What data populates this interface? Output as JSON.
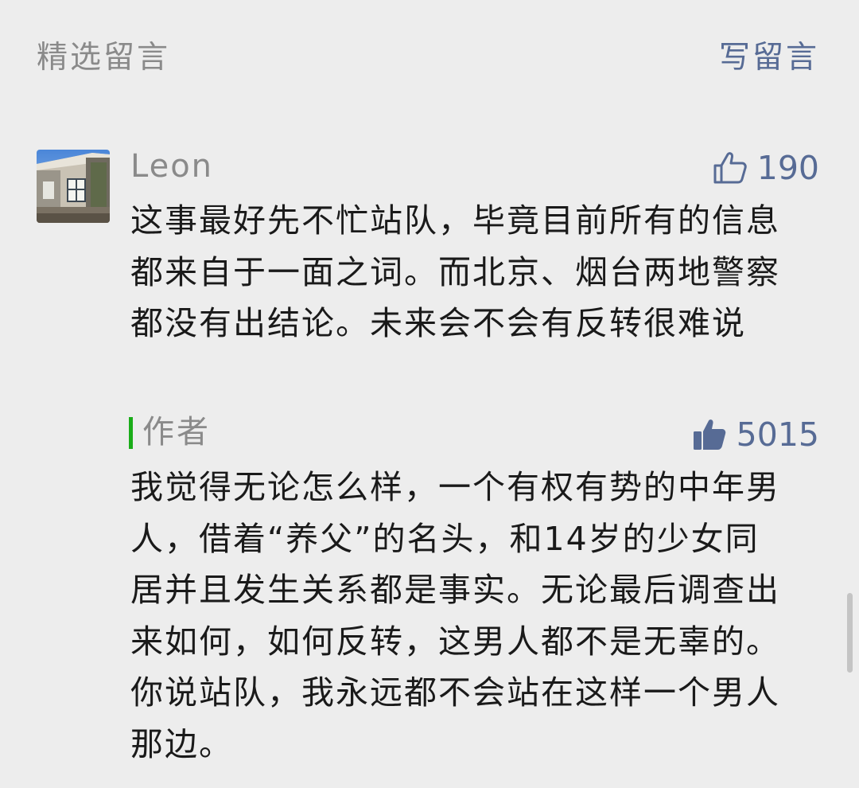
{
  "header": {
    "title": "精选留言",
    "write_label": "写留言"
  },
  "comment": {
    "user": "Leon",
    "likes": "190",
    "text": "这事最好先不忙站队，毕竟目前所有的信息都来自于一面之词。而北京、烟台两地警察都没有出结论。未来会不会有反转很难说"
  },
  "reply": {
    "author_label": "作者",
    "likes": "5015",
    "text": "我觉得无论怎么样，一个有权有势的中年男人，借着“养父”的名头，和14岁的少女同居并且发生关系都是事实。无论最后调查出来如何，如何反转，这男人都不是无辜的。你说站队，我永远都不会站在这样一个男人那边。"
  },
  "colors": {
    "background": "#ededed",
    "link": "#576b95",
    "muted": "#8a8a8a",
    "text": "#1a1a1a",
    "author_accent": "#1aad19"
  },
  "icons": {
    "like_outline": "thumbs-up-outline-icon",
    "like_filled": "thumbs-up-filled-icon"
  }
}
